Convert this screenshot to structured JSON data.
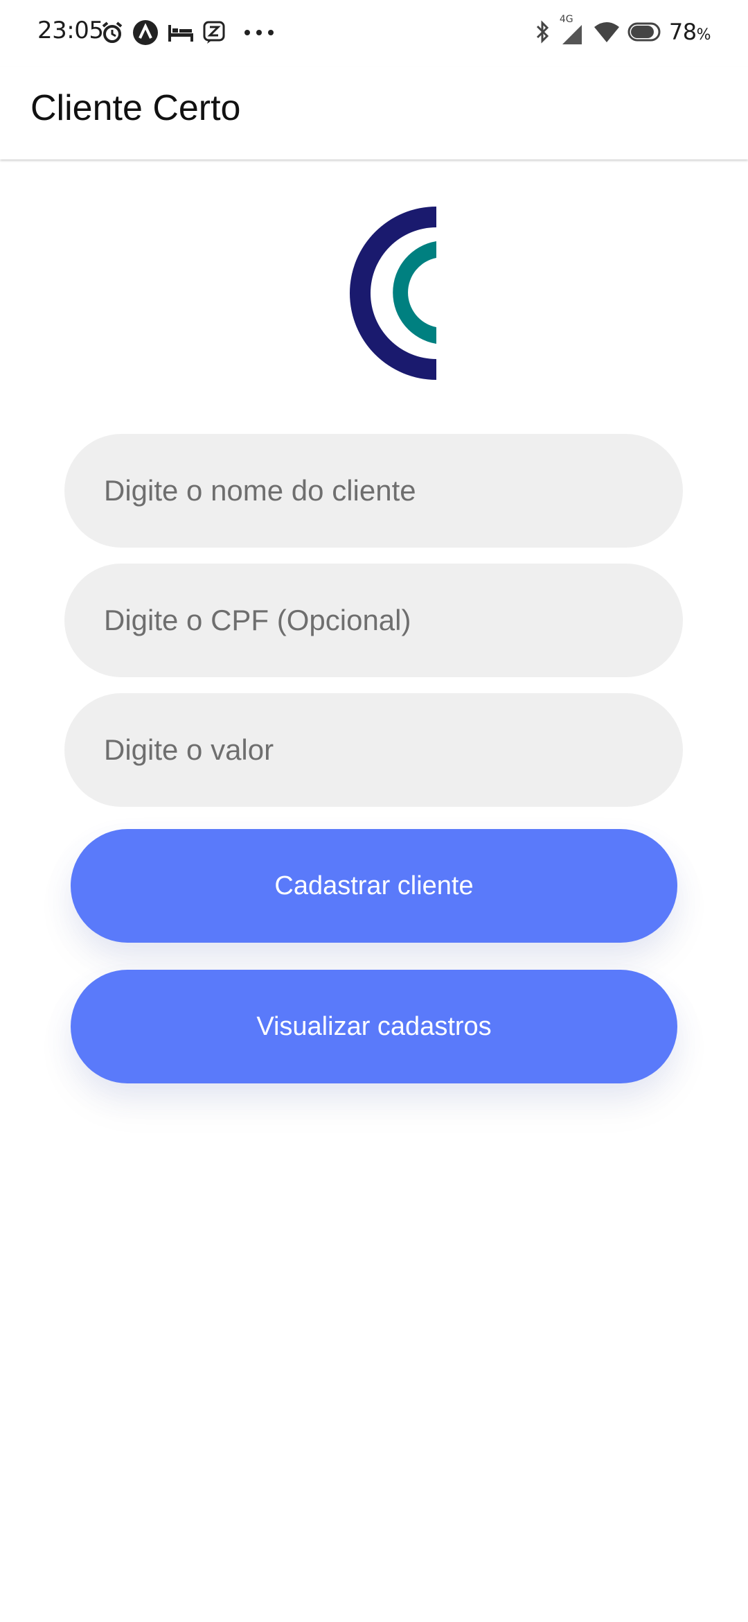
{
  "status_bar": {
    "time": "23:05",
    "network": "4G",
    "battery_percent": "78",
    "battery_unit": "%",
    "icons_left": [
      "alarm-icon",
      "app-a-icon",
      "bed-icon",
      "z-app-icon",
      "more-dots-icon"
    ],
    "icons_right": [
      "bluetooth-icon",
      "signal-icon",
      "wifi-icon",
      "battery-icon"
    ]
  },
  "app_bar": {
    "title": "Cliente Certo"
  },
  "logo": {
    "outer_color": "#1a1a6e",
    "inner_color": "#008080"
  },
  "form": {
    "name_placeholder": "Digite o nome do cliente",
    "name_value": "",
    "cpf_placeholder": "Digite o CPF (Opcional)",
    "cpf_value": "",
    "amount_placeholder": "Digite o valor",
    "amount_value": ""
  },
  "buttons": {
    "register_label": "Cadastrar cliente",
    "view_label": "Visualizar cadastros",
    "color": "#5a7afa"
  }
}
